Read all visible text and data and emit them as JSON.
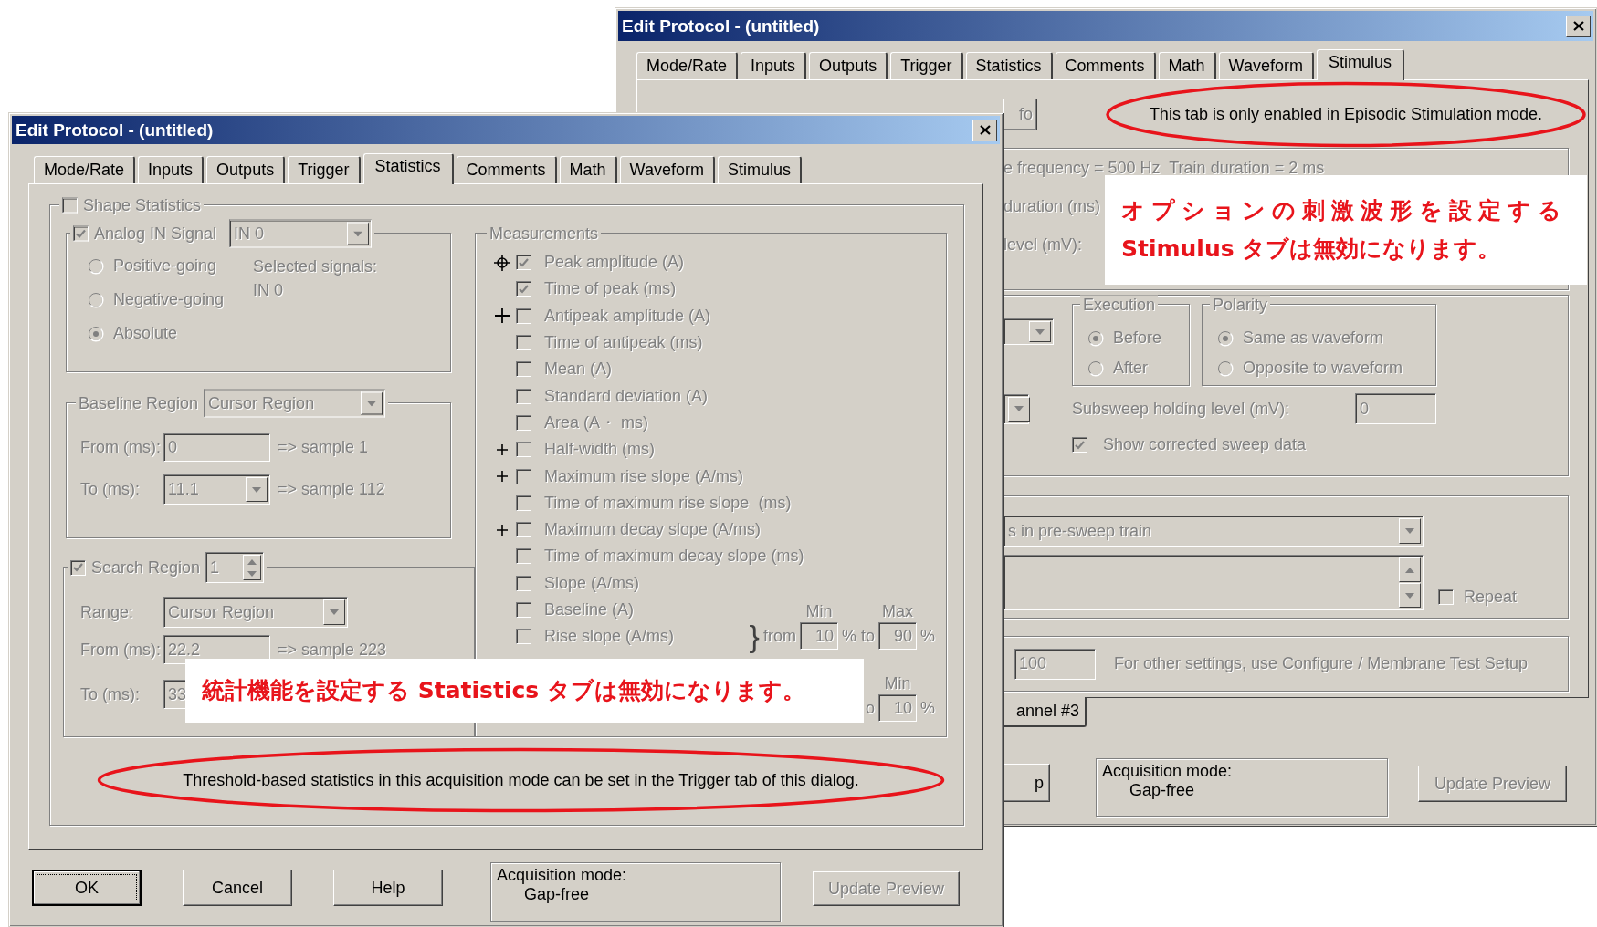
{
  "back_window": {
    "title": "Edit Protocol - (untitled)",
    "tabs": [
      {
        "label": "Mode/Rate",
        "selected": false
      },
      {
        "label": "Inputs",
        "selected": false
      },
      {
        "label": "Outputs",
        "selected": false
      },
      {
        "label": "Trigger",
        "selected": false
      },
      {
        "label": "Statistics",
        "selected": false
      },
      {
        "label": "Comments",
        "selected": false
      },
      {
        "label": "Math",
        "selected": false
      },
      {
        "label": "Waveform",
        "selected": false
      },
      {
        "label": "Stimulus",
        "selected": true
      }
    ],
    "info_button": "fo",
    "notice": "This tab is only enabled in Episodic Stimulation mode.",
    "train_lines": [
      "e frequency = 500 Hz  Train duration = 2 ms",
      "duration (ms)",
      "level (mV):"
    ],
    "execution": {
      "title": "Execution",
      "options": [
        {
          "label": "Before",
          "selected": true
        },
        {
          "label": "After",
          "selected": false
        }
      ]
    },
    "polarity": {
      "title": "Polarity",
      "options": [
        {
          "label": "Same as waveform",
          "selected": true
        },
        {
          "label": "Opposite to waveform",
          "selected": false
        }
      ]
    },
    "subsweep": {
      "label": "Subsweep holding level (mV):",
      "value": "0"
    },
    "show_corrected": {
      "label": "Show corrected sweep data",
      "checked": true
    },
    "train_select": "s in pre-sweep train",
    "repeat": {
      "label": "Repeat",
      "checked": false
    },
    "test_value": "100",
    "test_note": "For other settings, use Configure / Membrane Test Setup",
    "channel_tab": "annel #3",
    "help_button": "p",
    "acquisition": {
      "label": "Acquisition mode:",
      "value": "Gap-free"
    },
    "update_button": {
      "label": "Update Preview",
      "disabled": true
    }
  },
  "front_window": {
    "title": "Edit Protocol - (untitled)",
    "tabs": [
      {
        "label": "Mode/Rate",
        "selected": false
      },
      {
        "label": "Inputs",
        "selected": false
      },
      {
        "label": "Outputs",
        "selected": false
      },
      {
        "label": "Trigger",
        "selected": false
      },
      {
        "label": "Statistics",
        "selected": true
      },
      {
        "label": "Comments",
        "selected": false
      },
      {
        "label": "Math",
        "selected": false
      },
      {
        "label": "Waveform",
        "selected": false
      },
      {
        "label": "Stimulus",
        "selected": false
      }
    ],
    "shape_statistics": {
      "label": "Shape Statistics",
      "checked": false
    },
    "analog": {
      "label": "Analog IN Signal",
      "checked": true,
      "signal": "IN 0",
      "options": [
        {
          "label": "Positive-going",
          "selected": false
        },
        {
          "label": "Negative-going",
          "selected": false
        },
        {
          "label": "Absolute",
          "selected": true
        }
      ],
      "selected_label": "Selected signals:",
      "selected_value": "IN 0"
    },
    "baseline": {
      "label": "Baseline Region",
      "region": "Cursor Region",
      "from_label": "From (ms):",
      "from_value": "0",
      "from_sample": "=> sample 1",
      "to_label": "To (ms):",
      "to_value": "11.1",
      "to_sample": "=> sample 112"
    },
    "search": {
      "label": "Search Region",
      "checked": true,
      "spin": "1",
      "range_label": "Range:",
      "range_value": "Cursor Region",
      "from_label": "From (ms):",
      "from_value": "22.2",
      "from_sample": "=> sample 223",
      "to_label": "To (ms):",
      "to_value": "33"
    },
    "measurements": {
      "title": "Measurements",
      "items": [
        {
          "label": "Peak amplitude (A)",
          "checked": true,
          "kind": "crosshair"
        },
        {
          "label": "Time of peak (ms)",
          "checked": true,
          "kind": "plain"
        },
        {
          "label": "Antipeak amplitude (A)",
          "checked": false,
          "kind": "plus"
        },
        {
          "label": "Time of antipeak (ms)",
          "checked": false,
          "kind": "plain"
        },
        {
          "label": "Mean (A)",
          "checked": false,
          "kind": "plain"
        },
        {
          "label": "Standard deviation (A)",
          "checked": false,
          "kind": "plain"
        },
        {
          "label": "Area (A・ ms)",
          "checked": false,
          "kind": "plain"
        },
        {
          "label": "Half-width (ms)",
          "checked": false,
          "kind": "small-plus"
        },
        {
          "label": "Maximum rise slope (A/ms)",
          "checked": false,
          "kind": "small-plus"
        },
        {
          "label": "Time of maximum rise slope  (ms)",
          "checked": false,
          "kind": "plain"
        },
        {
          "label": "Maximum decay slope (A/ms)",
          "checked": false,
          "kind": "small-plus"
        },
        {
          "label": "Time of maximum decay slope (ms)",
          "checked": false,
          "kind": "plain"
        },
        {
          "label": "Slope (A/ms)",
          "checked": false,
          "kind": "plain"
        },
        {
          "label": "Baseline (A)",
          "checked": false,
          "kind": "plain"
        },
        {
          "label": "Rise slope (A/ms)",
          "checked": false,
          "kind": "plain",
          "range": {
            "brace": "}",
            "from": "from",
            "min_header": "Min",
            "min": "10",
            "to": "% to",
            "max_header": "Max",
            "max": "90",
            "unit": "%"
          }
        }
      ],
      "partial": {
        "text": "o",
        "header": "Min",
        "value": "10",
        "unit": "%"
      }
    },
    "threshold_note": "Threshold-based statistics in this acquisition mode can be set in the Trigger tab of this dialog.",
    "buttons": [
      {
        "label": "OK",
        "default": true
      },
      {
        "label": "Cancel",
        "default": false
      },
      {
        "label": "Help",
        "default": false
      }
    ],
    "acquisition": {
      "label": "Acquisition mode:",
      "value": "Gap-free"
    },
    "update_button": {
      "label": "Update Preview",
      "disabled": true
    }
  },
  "annotations": [
    {
      "lines": [
        "オプションの刺激波形を設定する",
        "Stimulus タブは無効になります。"
      ]
    },
    {
      "lines": [
        "統計機能を設定する Statistics タブは無効になります。"
      ]
    }
  ]
}
